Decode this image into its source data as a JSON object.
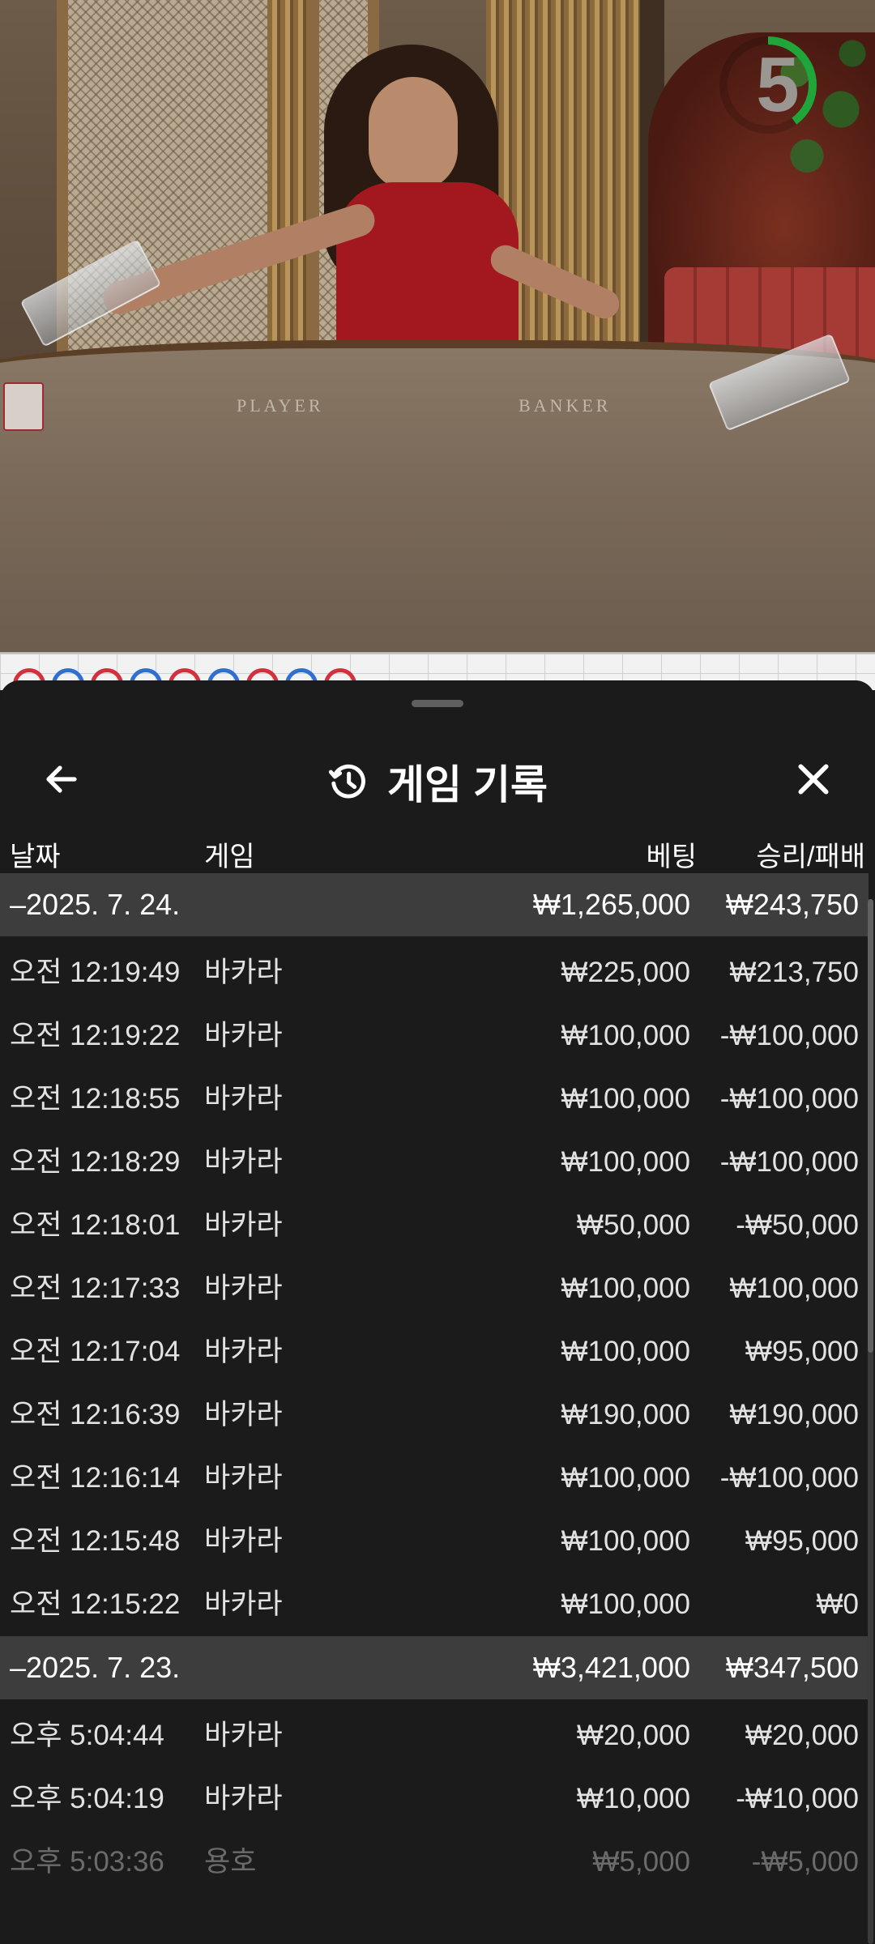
{
  "stream": {
    "countdown": "5",
    "countdown_progress": 0.4,
    "table_labels": {
      "player": "PLAYER",
      "banker": "BANKER"
    }
  },
  "roadmap": {
    "rings": [
      "red",
      "blue",
      "red",
      "blue",
      "red",
      "blue",
      "red",
      "blue",
      "red"
    ]
  },
  "sheet": {
    "title": "게임 기록",
    "back_icon": "arrow-left-icon",
    "history_icon": "history-clock-icon",
    "close_icon": "close-x-icon",
    "columns": {
      "date": "날짜",
      "game": "게임",
      "bet": "베팅",
      "result": "승리/패배"
    },
    "groups": [
      {
        "date": "–2025. 7. 24.",
        "bet_total": "₩1,265,000",
        "result_total": "₩243,750",
        "rows": [
          {
            "time": "오전 12:19:49",
            "game": "바카라",
            "bet": "₩225,000",
            "result": "₩213,750"
          },
          {
            "time": "오전 12:19:22",
            "game": "바카라",
            "bet": "₩100,000",
            "result": "-₩100,000"
          },
          {
            "time": "오전 12:18:55",
            "game": "바카라",
            "bet": "₩100,000",
            "result": "-₩100,000"
          },
          {
            "time": "오전 12:18:29",
            "game": "바카라",
            "bet": "₩100,000",
            "result": "-₩100,000"
          },
          {
            "time": "오전 12:18:01",
            "game": "바카라",
            "bet": "₩50,000",
            "result": "-₩50,000"
          },
          {
            "time": "오전 12:17:33",
            "game": "바카라",
            "bet": "₩100,000",
            "result": "₩100,000"
          },
          {
            "time": "오전 12:17:04",
            "game": "바카라",
            "bet": "₩100,000",
            "result": "₩95,000"
          },
          {
            "time": "오전 12:16:39",
            "game": "바카라",
            "bet": "₩190,000",
            "result": "₩190,000"
          },
          {
            "time": "오전 12:16:14",
            "game": "바카라",
            "bet": "₩100,000",
            "result": "-₩100,000"
          },
          {
            "time": "오전 12:15:48",
            "game": "바카라",
            "bet": "₩100,000",
            "result": "₩95,000"
          },
          {
            "time": "오전 12:15:22",
            "game": "바카라",
            "bet": "₩100,000",
            "result": "₩0"
          }
        ]
      },
      {
        "date": "–2025. 7. 23.",
        "bet_total": "₩3,421,000",
        "result_total": "₩347,500",
        "rows": [
          {
            "time": "오후 5:04:44",
            "game": "바카라",
            "bet": "₩20,000",
            "result": "₩20,000"
          },
          {
            "time": "오후 5:04:19",
            "game": "바카라",
            "bet": "₩10,000",
            "result": "-₩10,000"
          },
          {
            "time": "오후 5:03:36",
            "game": "용호",
            "bet": "₩5,000",
            "result": "-₩5,000"
          }
        ]
      }
    ]
  }
}
